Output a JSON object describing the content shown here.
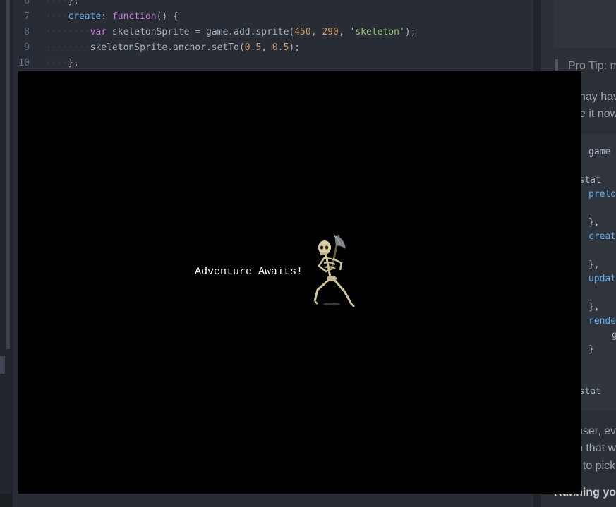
{
  "editor": {
    "lines": [
      {
        "num": "6",
        "indent": "····",
        "text": "},"
      },
      {
        "num": "7",
        "indent": "····",
        "parts": [
          [
            "fn",
            "create"
          ],
          [
            "p",
            ": "
          ],
          [
            "kw",
            "function"
          ],
          [
            "p",
            "() {"
          ]
        ]
      },
      {
        "num": "8",
        "indent": "········",
        "parts": [
          [
            "kw",
            "var"
          ],
          [
            "p",
            " skeletonSprite = game.add.sprite("
          ],
          [
            "num",
            "450"
          ],
          [
            "p",
            ", "
          ],
          [
            "num",
            "290"
          ],
          [
            "p",
            ", "
          ],
          [
            "str",
            "'skeleton'"
          ],
          [
            "p",
            ");"
          ]
        ]
      },
      {
        "num": "9",
        "indent": "········",
        "parts": [
          [
            "p",
            "skeletonSprite.anchor.setTo("
          ],
          [
            "num",
            "0.5"
          ],
          [
            "p",
            ", "
          ],
          [
            "num",
            "0.5"
          ],
          [
            "p",
            ");"
          ]
        ]
      },
      {
        "num": "10",
        "indent": "····",
        "text": "},"
      }
    ]
  },
  "doc": {
    "pro_tip": "Pro Tip: m",
    "para1": [
      "nay hav",
      "e it now"
    ],
    "code_lines": [
      {
        "text": "game",
        "blue": false
      },
      {
        "text": "e.stat",
        "blue": false
      },
      {
        "text": "prelo",
        "blue": true
      },
      {
        "text": "},",
        "blue": false
      },
      {
        "text": "creat",
        "blue": true
      },
      {
        "text": "},",
        "blue": false
      },
      {
        "text": "updat",
        "blue": true
      },
      {
        "text": "},",
        "blue": false
      },
      {
        "text": "rende",
        "blue": true
      },
      {
        "text": "g",
        "blue": false
      },
      {
        "text": "}",
        "blue": false
      },
      {
        "text": "e.stat",
        "blue": false
      }
    ],
    "para2": [
      "aser, ev",
      "n that w",
      "t to pick"
    ],
    "heading": "Running yo"
  },
  "game": {
    "text": "Adventure Awaits!"
  }
}
